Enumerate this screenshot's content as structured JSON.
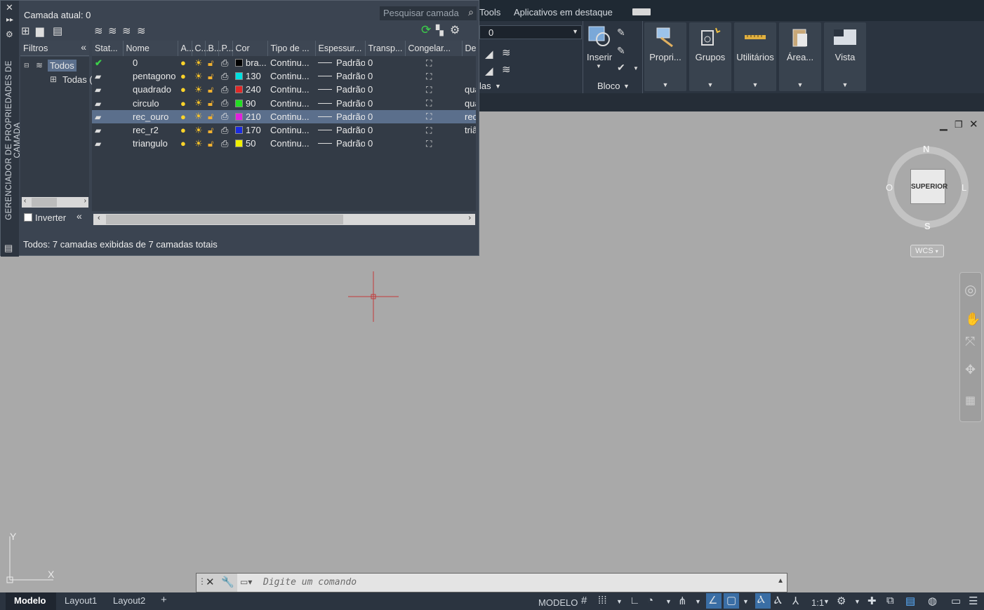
{
  "app": "AutoCAD",
  "layer_manager": {
    "current_layer": "Camada atual: 0",
    "search_placeholder": "Pesquisar camada",
    "side_title": "GERENCIADOR DE PROPRIEDADES DE CAMADA",
    "filters_label": "Filtros",
    "tree": {
      "root": "Todos",
      "child": "Todas ("
    },
    "invert_label": "Inverter",
    "status": "Todos: 7 camadas exibidas de 7 camadas totais",
    "columns": [
      "Stat...",
      "Nome",
      "A...",
      "C...",
      "B...",
      "P...",
      "Cor",
      "Tipo de ...",
      "Espessur...",
      "Transp...",
      "Congelar...",
      "De"
    ],
    "layers": [
      {
        "name": "0",
        "color_label": "bra...",
        "color": "#000000",
        "linetype": "Continu...",
        "lineweight": "Padrão",
        "transp": "0",
        "desc": "",
        "current": true,
        "selected": false
      },
      {
        "name": "pentagono",
        "color_label": "130",
        "color": "#00e0e0",
        "linetype": "Continu...",
        "lineweight": "Padrão",
        "transp": "0",
        "desc": "",
        "current": false,
        "selected": false
      },
      {
        "name": "quadrado",
        "color_label": "240",
        "color": "#e02828",
        "linetype": "Continu...",
        "lineweight": "Padrão",
        "transp": "0",
        "desc": "qua",
        "current": false,
        "selected": false
      },
      {
        "name": "circulo",
        "color_label": "90",
        "color": "#22dd22",
        "linetype": "Continu...",
        "lineweight": "Padrão",
        "transp": "0",
        "desc": "qua",
        "current": false,
        "selected": false
      },
      {
        "name": "rec_ouro",
        "color_label": "210",
        "color": "#e020e0",
        "linetype": "Continu...",
        "lineweight": "Padrão",
        "transp": "0",
        "desc": "rec",
        "current": false,
        "selected": true
      },
      {
        "name": "rec_r2",
        "color_label": "170",
        "color": "#1a2ae0",
        "linetype": "Continu...",
        "lineweight": "Padrão",
        "transp": "0",
        "desc": "triâ",
        "current": false,
        "selected": false
      },
      {
        "name": "triangulo",
        "color_label": "50",
        "color": "#f0f000",
        "linetype": "Continu...",
        "lineweight": "Padrão",
        "transp": "0",
        "desc": "",
        "current": false,
        "selected": false
      }
    ]
  },
  "ribbon": {
    "tabs": [
      "Tools",
      "Aplicativos em destaque"
    ],
    "layer_value": "0",
    "layers_label": "las",
    "insert_label": "Inserir",
    "block_label": "Bloco",
    "panels": [
      "Propri...",
      "Grupos",
      "Utilitários",
      "Área...",
      "Vista"
    ]
  },
  "viewcube": {
    "top": "SUPERIOR",
    "n": "N",
    "s": "S",
    "e": "L",
    "w": "O",
    "wcs": "WCS"
  },
  "ucs": {
    "x": "X",
    "y": "Y"
  },
  "command": {
    "placeholder": "Digite um comando"
  },
  "statusbar": {
    "tabs": [
      "Modelo",
      "Layout1",
      "Layout2"
    ],
    "add": "+",
    "model": "MODELO",
    "scale": "1:1"
  }
}
